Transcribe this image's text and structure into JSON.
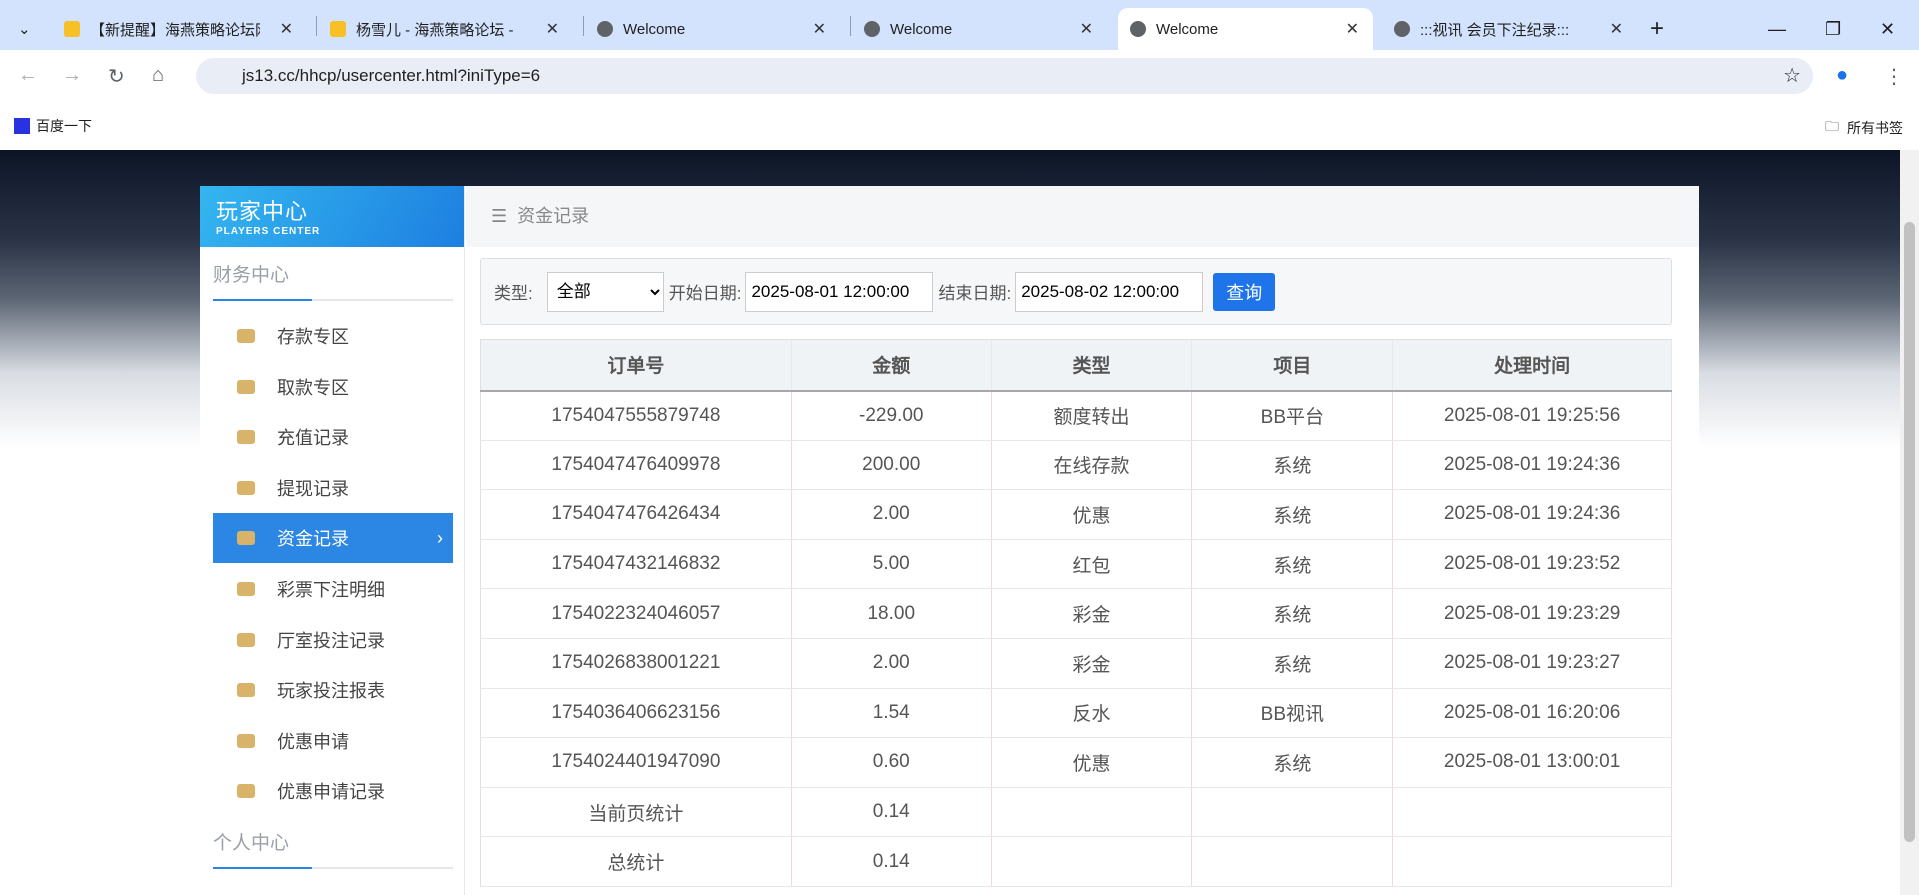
{
  "browser": {
    "tabs": [
      {
        "title": "【新提醒】海燕策略论坛网",
        "icon": "yellow"
      },
      {
        "title": "杨雪儿 - 海燕策略论坛 -",
        "icon": "yellow"
      },
      {
        "title": "Welcome",
        "icon": "globe"
      },
      {
        "title": "Welcome",
        "icon": "globe"
      },
      {
        "title": "Welcome",
        "icon": "globe",
        "active": true
      },
      {
        "title": ":::视讯 会员下注纪录:::",
        "icon": "globe"
      }
    ],
    "url": "js13.cc/hhcp/usercenter.html?iniType=6",
    "bookmark": "百度一下",
    "all_bookmarks": "所有书签"
  },
  "sidebar": {
    "logo_title": "玩家中心",
    "logo_sub": "PLAYERS CENTER",
    "section1": "财务中心",
    "items": [
      "存款专区",
      "取款专区",
      "充值记录",
      "提现记录",
      "资金记录",
      "彩票下注明细",
      "厅室投注记录",
      "玩家投注报表",
      "优惠申请",
      "优惠申请记录"
    ],
    "active": "资金记录",
    "section2": "个人中心"
  },
  "main": {
    "title": "资金记录",
    "filter": {
      "type_label": "类型:",
      "type_value": "全部",
      "start_label": "开始日期:",
      "start_value": "2025-08-01 12:00:00",
      "end_label": "结束日期:",
      "end_value": "2025-08-02 12:00:00",
      "query": "查询"
    },
    "table": {
      "headers": [
        "订单号",
        "金额",
        "类型",
        "项目",
        "处理时间"
      ],
      "rows": [
        [
          "1754047555879748",
          "-229.00",
          "额度转出",
          "BB平台",
          "2025-08-01 19:25:56"
        ],
        [
          "1754047476409978",
          "200.00",
          "在线存款",
          "系统",
          "2025-08-01 19:24:36"
        ],
        [
          "1754047476426434",
          "2.00",
          "优惠",
          "系统",
          "2025-08-01 19:24:36"
        ],
        [
          "1754047432146832",
          "5.00",
          "红包",
          "系统",
          "2025-08-01 19:23:52"
        ],
        [
          "1754022324046057",
          "18.00",
          "彩金",
          "系统",
          "2025-08-01 19:23:29"
        ],
        [
          "1754026838001221",
          "2.00",
          "彩金",
          "系统",
          "2025-08-01 19:23:27"
        ],
        [
          "1754036406623156",
          "1.54",
          "反水",
          "BB视讯",
          "2025-08-01 16:20:06"
        ],
        [
          "1754024401947090",
          "0.60",
          "优惠",
          "系统",
          "2025-08-01 13:00:01"
        ]
      ],
      "page_total_label": "当前页统计",
      "page_total": "0.14",
      "total_label": "总统计",
      "total": "0.14"
    }
  }
}
